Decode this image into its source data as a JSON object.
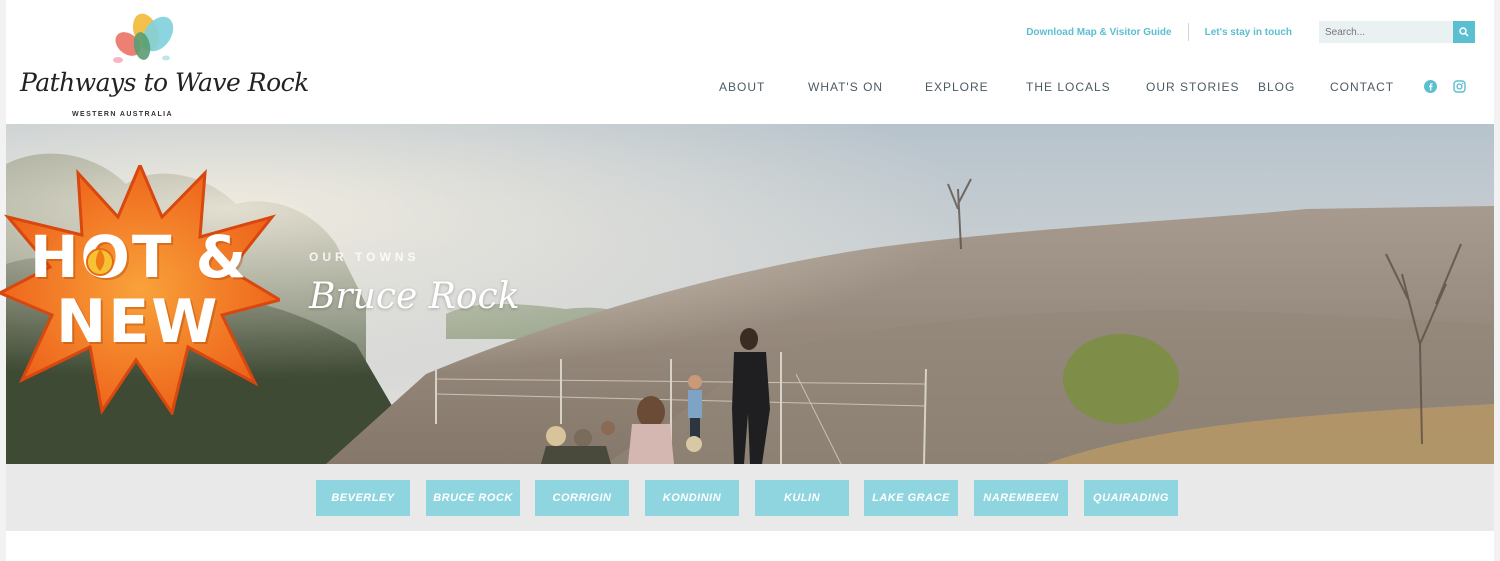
{
  "brand": {
    "name": "Pathways to Wave Rock",
    "tagline": "WESTERN AUSTRALIA",
    "colors": {
      "accent": "#5bbfd1",
      "town_button": "#8ed5df",
      "badge_orange": "#f26a1b",
      "nav_text": "#4b5b63"
    }
  },
  "utility": {
    "download_link": "Download Map & Visitor Guide",
    "stay_link": "Let's stay in touch",
    "search_placeholder": "Search..."
  },
  "nav": {
    "items": [
      "ABOUT",
      "WHAT'S ON",
      "EXPLORE",
      "THE LOCALS",
      "OUR STORIES",
      "BLOG",
      "CONTACT"
    ],
    "social": [
      "facebook-icon",
      "instagram-icon"
    ]
  },
  "hero": {
    "kicker": "OUR TOWNS",
    "title": "Bruce Rock"
  },
  "badge": {
    "line1": "HOT &",
    "line2": "NEW",
    "icon": "flame-icon"
  },
  "towns": [
    "BEVERLEY",
    "BRUCE ROCK",
    "CORRIGIN",
    "KONDININ",
    "KULIN",
    "LAKE GRACE",
    "NAREMBEEN",
    "QUAIRADING"
  ]
}
